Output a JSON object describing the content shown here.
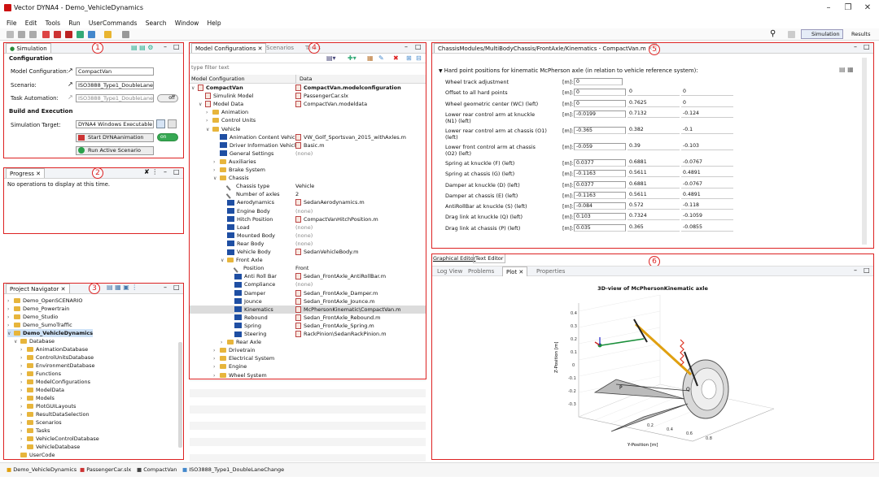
{
  "window": {
    "title": "Vector DYNA4 - Demo_VehicleDynamics"
  },
  "menu": [
    "File",
    "Edit",
    "Tools",
    "Run",
    "UserCommands",
    "Search",
    "Window",
    "Help"
  ],
  "perspectives": {
    "simulation": "Simulation",
    "results": "Results"
  },
  "simulation": {
    "tab": "Simulation",
    "badge": "1",
    "config_title": "Configuration",
    "model_config_label": "Model Configuration:",
    "model_config_value": "CompactVan",
    "scenario_label": "Scenario:",
    "scenario_value": "ISO3888_Type1_DoubleLaneCh",
    "task_label": "Task Automation:",
    "task_value": "ISO3888_Type1_DoubleLaneCh",
    "task_toggle": "off",
    "build_title": "Build and Execution",
    "target_label": "Simulation Target:",
    "target_value": "DYNA4 Windows Executable",
    "start_anim": "Start DYNAanimation",
    "anim_toggle": "on",
    "run_active": "Run Active Scenario"
  },
  "progress": {
    "tab": "Progress",
    "badge": "2",
    "message": "No operations to display at this time."
  },
  "navigator": {
    "tab": "Project Navigator",
    "badge": "3",
    "items": [
      {
        "label": "Demo_OpenSCENARIO",
        "level": 0,
        "open": false,
        "bold": false
      },
      {
        "label": "Demo_Powertrain",
        "level": 0,
        "open": false,
        "bold": false
      },
      {
        "label": "Demo_Studio",
        "level": 0,
        "open": false,
        "bold": false
      },
      {
        "label": "Demo_SumoTraffic",
        "level": 0,
        "open": false,
        "bold": false
      },
      {
        "label": "Demo_VehicleDynamics",
        "level": 0,
        "open": true,
        "bold": true
      },
      {
        "label": "Database",
        "level": 1,
        "open": true,
        "bold": false
      },
      {
        "label": "AnimationDatabase",
        "level": 2,
        "open": false,
        "bold": false
      },
      {
        "label": "ControlUnitsDatabase",
        "level": 2,
        "open": false,
        "bold": false
      },
      {
        "label": "EnvironmentDatabase",
        "level": 2,
        "open": false,
        "bold": false
      },
      {
        "label": "Functions",
        "level": 2,
        "open": false,
        "bold": false
      },
      {
        "label": "ModelConfigurations",
        "level": 2,
        "open": false,
        "bold": false
      },
      {
        "label": "ModelData",
        "level": 2,
        "open": false,
        "bold": false
      },
      {
        "label": "Models",
        "level": 2,
        "open": false,
        "bold": false
      },
      {
        "label": "PlotGUILayouts",
        "level": 2,
        "open": false,
        "bold": false
      },
      {
        "label": "ResultDataSelection",
        "level": 2,
        "open": false,
        "bold": false
      },
      {
        "label": "Scenarios",
        "level": 2,
        "open": false,
        "bold": false
      },
      {
        "label": "Tasks",
        "level": 2,
        "open": false,
        "bold": false
      },
      {
        "label": "VehicleControlDatabase",
        "level": 2,
        "open": false,
        "bold": false
      },
      {
        "label": "VehicleDatabase",
        "level": 2,
        "open": false,
        "bold": false
      },
      {
        "label": "UserCode",
        "level": 1,
        "open": null,
        "bold": false
      }
    ]
  },
  "model_config": {
    "tabs": [
      "Model Configurations",
      "Scenarios",
      "Tasks"
    ],
    "badge": "4",
    "filter_placeholder": "type filter text",
    "col_config": "Model Configuration",
    "col_data": "Data",
    "rows": [
      {
        "name": "CompactVan",
        "data": "CompactVan.modelconfiguration",
        "level": 0,
        "open": true,
        "icon": "cfg",
        "bold": true,
        "dbold": true
      },
      {
        "name": "Simulink Model",
        "data": "PassengerCar.slx",
        "level": 1,
        "open": null,
        "icon": "slk",
        "bold": false
      },
      {
        "name": "Model Data",
        "data": "CompactVan.modeldata",
        "level": 1,
        "open": true,
        "icon": "cfg",
        "bold": false
      },
      {
        "name": "Animation",
        "data": "",
        "level": 2,
        "open": false,
        "icon": "fold"
      },
      {
        "name": "Control Units",
        "data": "",
        "level": 2,
        "open": false,
        "icon": "fold"
      },
      {
        "name": "Vehicle",
        "data": "",
        "level": 2,
        "open": true,
        "icon": "fold"
      },
      {
        "name": "Animation Content Vehicle",
        "data": "VW_Golf_Sportsvan_2015_withAxles.m",
        "level": 3,
        "open": null,
        "icon": "blk"
      },
      {
        "name": "Driver Information Vehicle",
        "data": "Basic.m",
        "level": 3,
        "open": null,
        "icon": "blk"
      },
      {
        "name": "General Settings",
        "data": "(none)",
        "level": 3,
        "open": null,
        "icon": "blk"
      },
      {
        "name": "Auxiliaries",
        "data": "",
        "level": 3,
        "open": false,
        "icon": "fold"
      },
      {
        "name": "Brake System",
        "data": "",
        "level": 3,
        "open": false,
        "icon": "fold"
      },
      {
        "name": "Chassis",
        "data": "",
        "level": 3,
        "open": true,
        "icon": "fold"
      },
      {
        "name": "Chassis type",
        "data": "Vehicle",
        "level": 4,
        "open": null,
        "icon": "wr"
      },
      {
        "name": "Number of axles",
        "data": "2",
        "level": 4,
        "open": null,
        "icon": "wr"
      },
      {
        "name": "Aerodynamics",
        "data": "SedanAerodynamics.m",
        "level": 4,
        "open": null,
        "icon": "blk"
      },
      {
        "name": "Engine Body",
        "data": "(none)",
        "level": 4,
        "open": null,
        "icon": "blk"
      },
      {
        "name": "Hitch Position",
        "data": "CompactVanHitchPosition.m",
        "level": 4,
        "open": null,
        "icon": "blk"
      },
      {
        "name": "Load",
        "data": "(none)",
        "level": 4,
        "open": null,
        "icon": "blk"
      },
      {
        "name": "Mounted Body",
        "data": "(none)",
        "level": 4,
        "open": null,
        "icon": "blk"
      },
      {
        "name": "Rear Body",
        "data": "(none)",
        "level": 4,
        "open": null,
        "icon": "blk"
      },
      {
        "name": "Vehicle Body",
        "data": "SedanVehicleBody.m",
        "level": 4,
        "open": null,
        "icon": "blk"
      },
      {
        "name": "Front Axle",
        "data": "",
        "level": 4,
        "open": true,
        "icon": "fold"
      },
      {
        "name": "Position",
        "data": "Front",
        "level": 5,
        "open": null,
        "icon": "wr"
      },
      {
        "name": "Anti Roll Bar",
        "data": "Sedan_FrontAxle_AntiRollBar.m",
        "level": 5,
        "open": null,
        "icon": "blk"
      },
      {
        "name": "Compliance",
        "data": "(none)",
        "level": 5,
        "open": null,
        "icon": "blk"
      },
      {
        "name": "Damper",
        "data": "Sedan_FrontAxle_Damper.m",
        "level": 5,
        "open": null,
        "icon": "blk"
      },
      {
        "name": "Jounce",
        "data": "Sedan_FrontAxle_Jounce.m",
        "level": 5,
        "open": null,
        "icon": "blk"
      },
      {
        "name": "Kinematics",
        "data": "McPhersonKinematic\\CompactVan.m",
        "level": 5,
        "open": null,
        "icon": "blk",
        "selected": true
      },
      {
        "name": "Rebound",
        "data": "Sedan_FrontAxle_Rebound.m",
        "level": 5,
        "open": null,
        "icon": "blk"
      },
      {
        "name": "Spring",
        "data": "Sedan_FrontAxle_Spring.m",
        "level": 5,
        "open": null,
        "icon": "blk"
      },
      {
        "name": "Steering",
        "data": "RackPinion\\SedanRackPinion.m",
        "level": 5,
        "open": null,
        "icon": "blk"
      },
      {
        "name": "Rear Axle",
        "data": "",
        "level": 4,
        "open": false,
        "icon": "fold"
      },
      {
        "name": "Drivetrain",
        "data": "",
        "level": 3,
        "open": false,
        "icon": "fold"
      },
      {
        "name": "Electrical System",
        "data": "",
        "level": 3,
        "open": false,
        "icon": "fold"
      },
      {
        "name": "Engine",
        "data": "",
        "level": 3,
        "open": false,
        "icon": "fold"
      },
      {
        "name": "Wheel System",
        "data": "",
        "level": 3,
        "open": false,
        "icon": "fold"
      }
    ]
  },
  "editor": {
    "tab": "ChassisModules/MultiBodyChassis/FrontAxle/Kinematics - CompactVan.m",
    "badge": "5",
    "section": "Hard point positions for kinematic McPherson axle (in relation to vehicle reference system):",
    "params": [
      {
        "label": "Wheel track adjustment",
        "unit": "[m]:",
        "v": [
          "0"
        ]
      },
      {
        "label": "Offset to all hard points",
        "unit": "[m]:",
        "v": [
          "0",
          "0",
          "0"
        ]
      },
      {
        "label": "Wheel geometric center (WC) (left)",
        "unit": "[m]:",
        "v": [
          "0",
          "0.7625",
          "0"
        ]
      },
      {
        "label": "Lower rear control arm at knuckle",
        "label2": "(N1) (left)",
        "unit": "[m]:",
        "v": [
          "-0.0199",
          "0.7132",
          "-0.124"
        ]
      },
      {
        "label": "Lower rear control arm at chassis (O1)",
        "label2": "(left)",
        "unit": "[m]:",
        "v": [
          "-0.365",
          "0.382",
          "-0.1"
        ]
      },
      {
        "label": "Lower front control arm at chassis",
        "label2": "(O2) (left)",
        "unit": "[m]:",
        "v": [
          "-0.059",
          "0.39",
          "-0.103"
        ]
      },
      {
        "label": "Spring at knuckle (F) (left)",
        "unit": "[m]:",
        "v": [
          "0.0377",
          "0.6881",
          "-0.0767"
        ]
      },
      {
        "label": "Spring at chassis (G) (left)",
        "unit": "[m]:",
        "v": [
          "-0.1163",
          "0.5611",
          "0.4891"
        ]
      },
      {
        "label": "Damper at knuckle (D) (left)",
        "unit": "[m]:",
        "v": [
          "0.0377",
          "0.6881",
          "-0.0767"
        ]
      },
      {
        "label": "Damper at chassis (E) (left)",
        "unit": "[m]:",
        "v": [
          "-0.1163",
          "0.5611",
          "0.4891"
        ]
      },
      {
        "label": "AntiRollBar at knuckle (S) (left)",
        "unit": "[m]:",
        "v": [
          "-0.084",
          "0.572",
          "-0.118"
        ]
      },
      {
        "label": "Drag link at knuckle (Q) (left)",
        "unit": "[m]:",
        "v": [
          "0.103",
          "0.7324",
          "-0.1059"
        ]
      },
      {
        "label": "Drag link at chassis (P) (left)",
        "unit": "[m]:",
        "v": [
          "0.035",
          "0.365",
          "-0.0855"
        ]
      }
    ]
  },
  "plotpanel": {
    "tabs_top": [
      "Graphical Editor",
      "Text Editor"
    ],
    "badge": "6",
    "tabs": [
      "Log View",
      "Problems",
      "Plot",
      "Properties"
    ],
    "title": "3D-view of McPhersonKinematic axle",
    "ylabel": "Z-Position [m]",
    "xlabel": "Y-Position [m]",
    "ticks": [
      "0.4",
      "0.3",
      "0.2",
      "0.1",
      "0",
      "-0.1",
      "-0.2",
      "-0.3"
    ],
    "xticks": [
      "0.8",
      "0.6",
      "0.4",
      "0.2"
    ],
    "point_labels": [
      "P",
      "Q"
    ]
  },
  "statusbar": [
    "Demo_VehicleDynamics",
    "PassengerCar.slx",
    "CompactVan",
    "ISO3888_Type1_DoubleLaneChange"
  ]
}
